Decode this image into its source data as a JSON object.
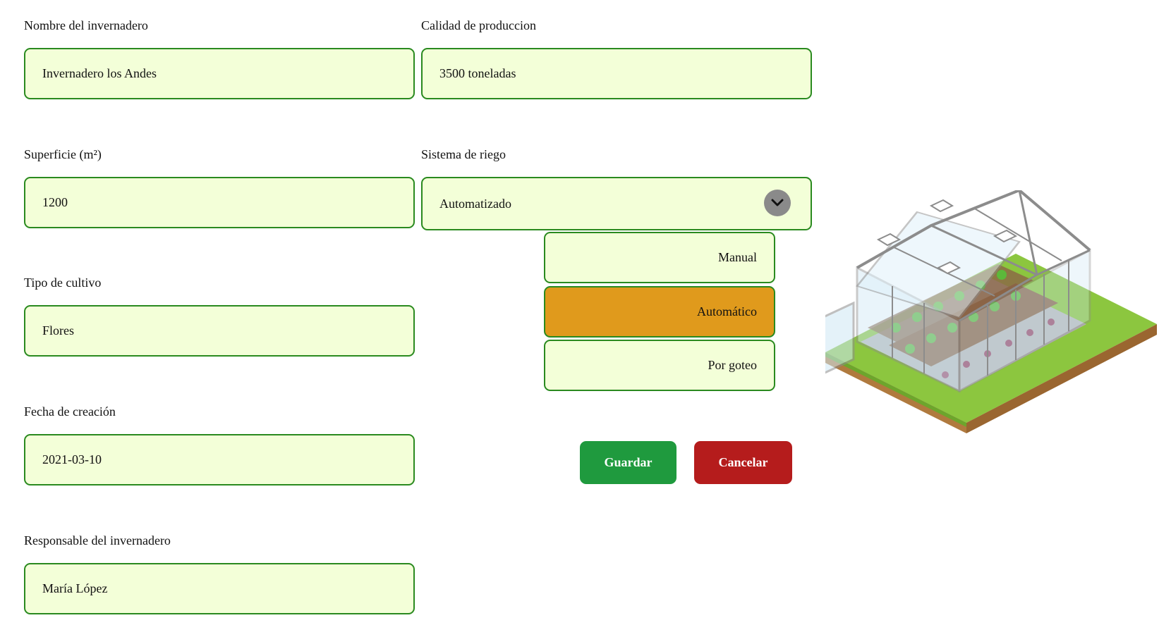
{
  "form": {
    "name_label": "Nombre del invernadero",
    "name_value": "Invernadero los Andes",
    "quality_label": "Calidad de produccion",
    "quality_value": "3500 toneladas",
    "area_label": "Superficie (m²)",
    "area_value": "1200",
    "irrigation_label": "Sistema de riego",
    "irrigation_value": "Automatizado",
    "crop_label": "Tipo de cultivo",
    "crop_value": "Flores",
    "date_label": "Fecha de creación",
    "date_value": "2021-03-10",
    "manager_label": "Responsable del invernadero",
    "manager_value": "María López"
  },
  "dropdown": {
    "options": [
      "Manual",
      "Automático",
      "Por goteo"
    ],
    "highlighted": "Automático"
  },
  "actions": {
    "save_label": "Guardar",
    "cancel_label": "Cancelar"
  },
  "colors": {
    "field_bg": "#f3ffd8",
    "field_border": "#2a8a1f",
    "highlight": "#e09a1c",
    "save": "#1f9a3e",
    "cancel": "#b51c1c"
  },
  "icons": {
    "dropdown": "chevron-down-icon",
    "illustration": "greenhouse-illustration"
  }
}
